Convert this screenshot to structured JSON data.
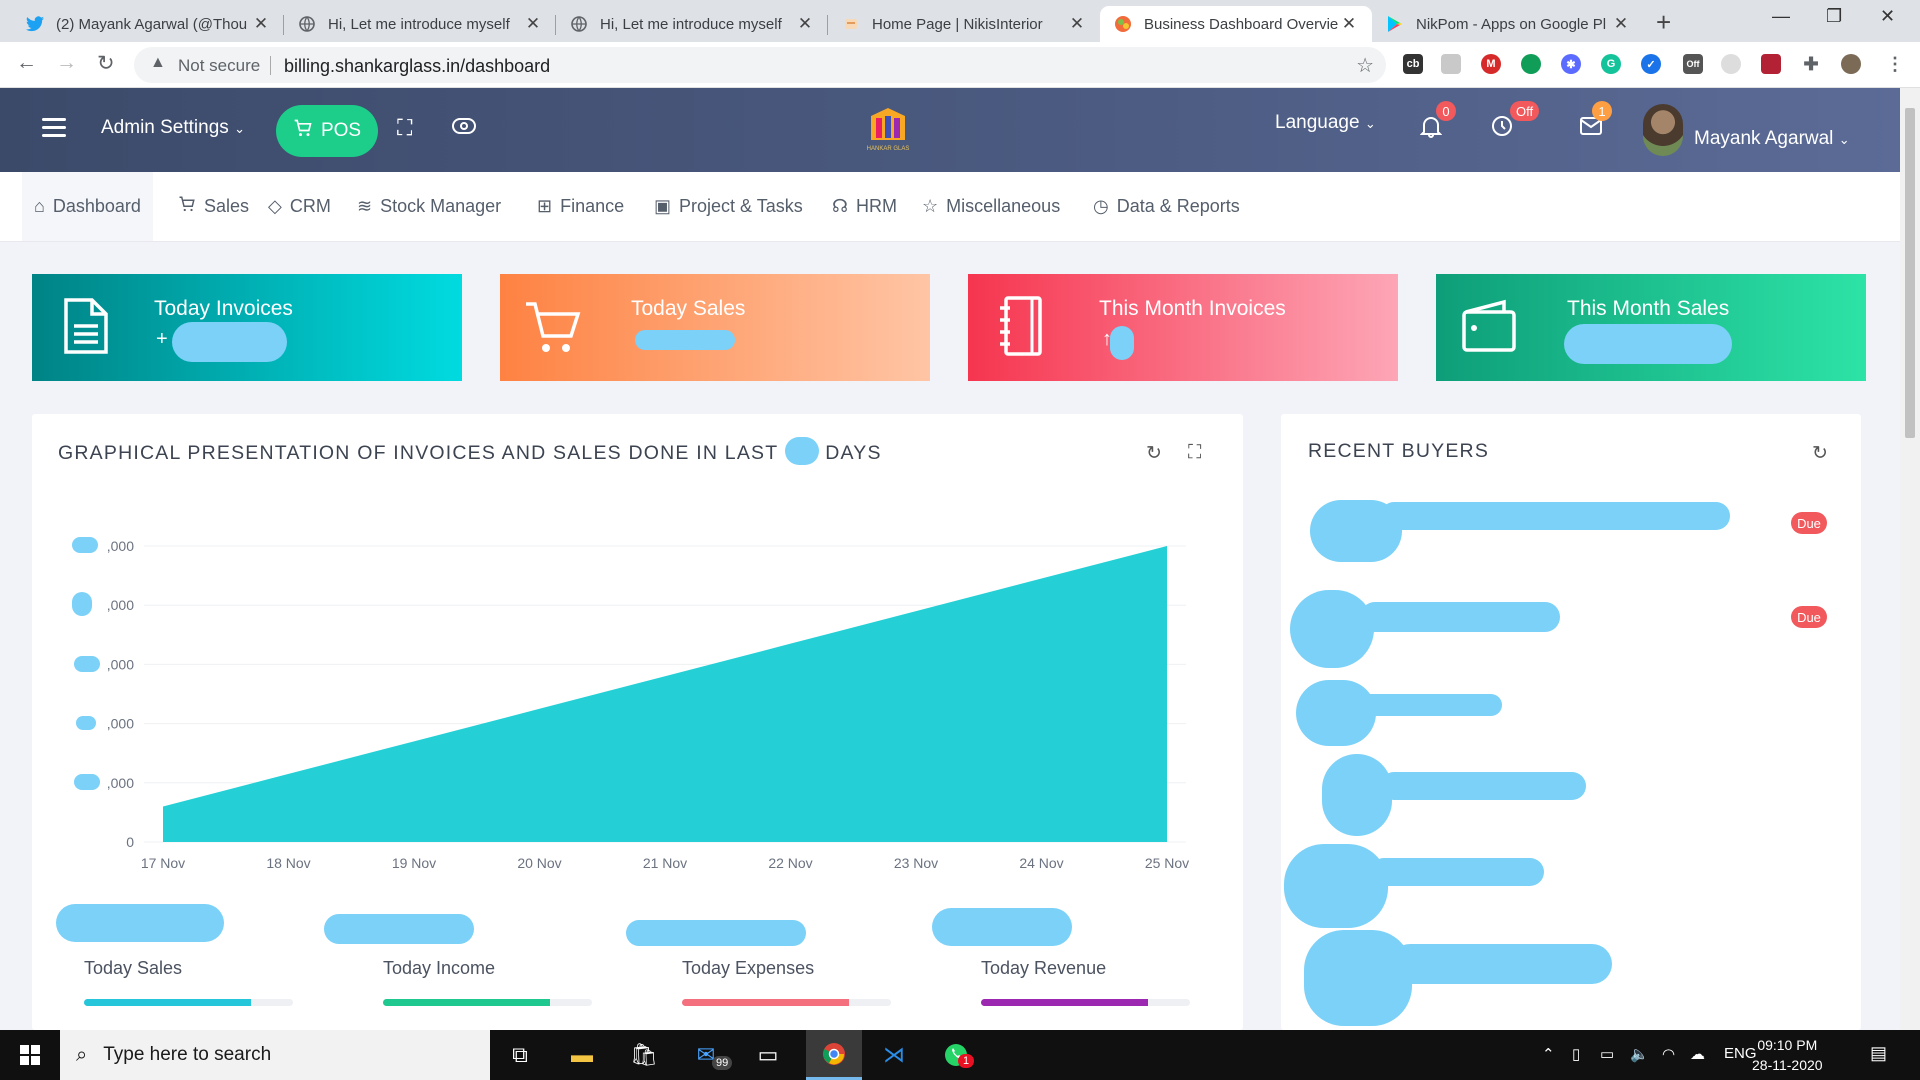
{
  "browser": {
    "tabs": [
      {
        "title": "(2) Mayank Agarwal (@Thou",
        "icon": "twitter-icon"
      },
      {
        "title": "Hi, Let me introduce myself",
        "icon": "globe-icon"
      },
      {
        "title": "Hi, Let me introduce myself",
        "icon": "globe-icon"
      },
      {
        "title": "Home Page | NikisInterior",
        "icon": "page-icon"
      },
      {
        "title": "Business Dashboard Overvie",
        "icon": "dashboard-icon"
      },
      {
        "title": "NikPom - Apps on Google Pl",
        "icon": "play-store-icon"
      }
    ],
    "active_tab": 4,
    "not_secure": "Not secure",
    "url": "billing.shankarglass.in/dashboard",
    "ext_badges": {
      "cb": "cb",
      "off": "Off"
    }
  },
  "header": {
    "admin_settings": "Admin Settings",
    "pos_label": "POS",
    "logo_text": "SHANKAR GLASS",
    "language": "Language",
    "notifications_count": "0",
    "clock_status": "Off",
    "messages_count": "1",
    "user_name": "Mayank Agarwal"
  },
  "menu": [
    {
      "label": "Dashboard",
      "icon": "home-icon"
    },
    {
      "label": "Sales",
      "icon": "cart-icon"
    },
    {
      "label": "CRM",
      "icon": "diamond-icon"
    },
    {
      "label": "Stock Manager",
      "icon": "layers-icon"
    },
    {
      "label": "Finance",
      "icon": "calculator-icon"
    },
    {
      "label": "Project & Tasks",
      "icon": "briefcase-icon"
    },
    {
      "label": "HRM",
      "icon": "user-icon"
    },
    {
      "label": "Miscellaneous",
      "icon": "star-icon"
    },
    {
      "label": "Data & Reports",
      "icon": "clock-icon"
    }
  ],
  "cards": [
    {
      "title": "Today Invoices",
      "prefix": "+",
      "colors": [
        "#008385",
        "#00dbe0"
      ]
    },
    {
      "title": "Today Sales",
      "prefix": "",
      "colors": [
        "#fe8242",
        "#ffc5a5"
      ]
    },
    {
      "title": "This Month Invoices",
      "prefix": "↑",
      "colors": [
        "#f6354f",
        "#fda6b6"
      ]
    },
    {
      "title": "This Month Sales",
      "prefix": "",
      "colors": [
        "#0e9e79",
        "#2de3a6"
      ]
    }
  ],
  "graph_panel": {
    "title_start": "GRAPHICAL PRESENTATION OF INVOICES AND SALES DONE IN LAST",
    "title_end": "DAYS"
  },
  "chart_data": {
    "type": "area",
    "x": [
      "17 Nov",
      "18 Nov",
      "19 Nov",
      "20 Nov",
      "21 Nov",
      "22 Nov",
      "23 Nov",
      "24 Nov",
      "25 Nov"
    ],
    "y_tick_labels": [
      ",000",
      ",000",
      ",000",
      ",000",
      ",000",
      "0"
    ],
    "values_fraction_of_axis": [
      0.12,
      0.23,
      0.34,
      0.45,
      0.56,
      0.67,
      0.78,
      0.89,
      1.0
    ],
    "color": "#24d0d6",
    "grid": true
  },
  "kpis": [
    {
      "label": "Today Sales",
      "progress": 0.8,
      "color": "#26c6da"
    },
    {
      "label": "Today Income",
      "progress": 0.8,
      "color": "#1ec88f"
    },
    {
      "label": "Today Expenses",
      "progress": 0.8,
      "color": "#f4707f"
    },
    {
      "label": "Today Revenue",
      "progress": 0.8,
      "color": "#9c27b0"
    }
  ],
  "recent_buyers": {
    "title": "RECENT BUYERS",
    "due_label": "Due"
  },
  "taskbar": {
    "search_placeholder": "Type here to search",
    "mail_badge": "99",
    "whatsapp_badge": "1",
    "lang": "ENG",
    "time": "09:10 PM",
    "date": "28-11-2020"
  }
}
